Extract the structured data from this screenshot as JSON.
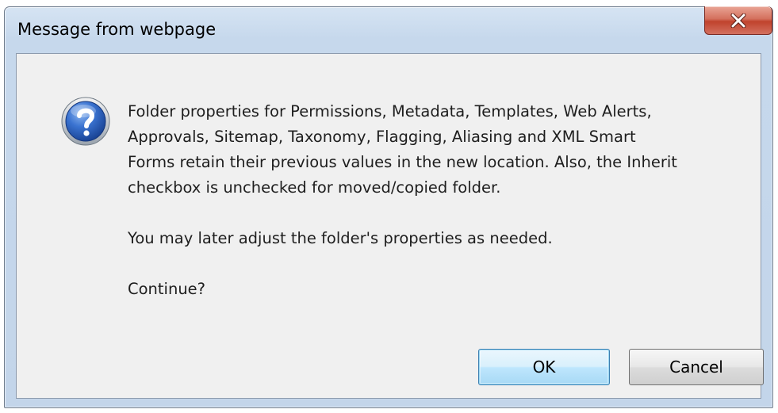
{
  "window": {
    "title": "Message from webpage",
    "close_glyph": "x"
  },
  "dialog": {
    "icon": "question-icon",
    "message_para1": "Folder properties for Permissions, Metadata, Templates, Web Alerts,\nApprovals, Sitemap, Taxonomy, Flagging, Aliasing and XML Smart\nForms retain their previous values in the new location. Also, the Inherit\ncheckbox is unchecked for moved/copied folder.",
    "message_para2": "You may later adjust the folder's properties as needed.",
    "message_para3": "Continue?"
  },
  "buttons": {
    "ok_label": "OK",
    "cancel_label": "Cancel"
  },
  "colors": {
    "close_button": "#c7503a",
    "icon_blue": "#2a63c4",
    "default_button_border": "#3c7fb1"
  }
}
